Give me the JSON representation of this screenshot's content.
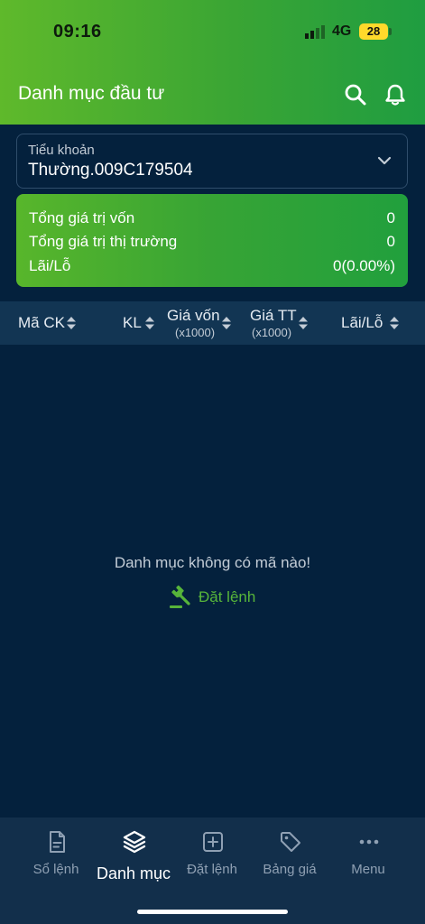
{
  "status_bar": {
    "time": "09:16",
    "network": "4G",
    "battery": "28"
  },
  "header": {
    "title": "Danh mục đầu tư",
    "search_icon": "search-icon",
    "bell_icon": "bell-icon"
  },
  "account": {
    "label": "Tiểu khoản",
    "value": "Thường.009C179504"
  },
  "summary": {
    "rows": [
      {
        "label": "Tổng giá trị vốn",
        "value": "0"
      },
      {
        "label": "Tổng giá trị thị trường",
        "value": "0"
      },
      {
        "label": "Lãi/Lỗ",
        "value": "0(0.00%)"
      }
    ]
  },
  "table": {
    "columns": [
      {
        "label": "Mã CK",
        "sub": ""
      },
      {
        "label": "KL",
        "sub": ""
      },
      {
        "label": "Giá vốn",
        "sub": "(x1000)"
      },
      {
        "label": "Giá TT",
        "sub": "(x1000)"
      },
      {
        "label": "Lãi/Lỗ",
        "sub": ""
      }
    ]
  },
  "empty_state": {
    "message": "Danh mục không có mã nào!",
    "action_label": "Đặt lệnh"
  },
  "bottom_nav": {
    "items": [
      {
        "label": "Sổ lệnh",
        "icon": "document-icon",
        "active": false
      },
      {
        "label": "Danh mục",
        "icon": "layers-icon",
        "active": true
      },
      {
        "label": "Đặt lệnh",
        "icon": "plus-square-icon",
        "active": false
      },
      {
        "label": "Bảng giá",
        "icon": "tag-icon",
        "active": false
      },
      {
        "label": "Menu",
        "icon": "more-icon",
        "active": false
      }
    ]
  },
  "colors": {
    "accent_green": "#57b53a",
    "background": "#04213d",
    "table_header": "#123553",
    "nav_background": "#122f4b"
  }
}
